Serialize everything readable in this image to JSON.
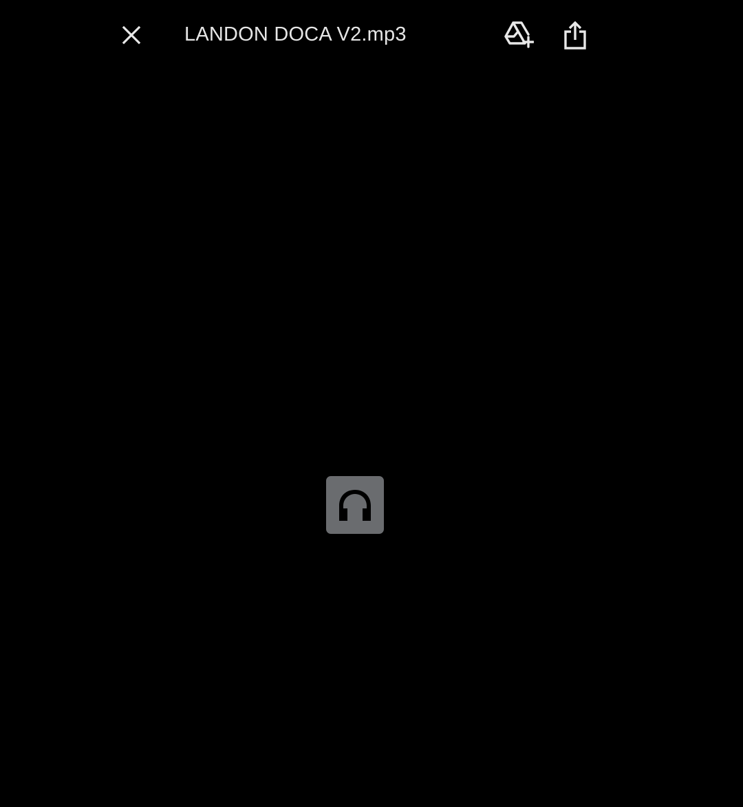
{
  "toolbar": {
    "close_icon": "close-icon",
    "title": "LANDON DOCA V2.mp3",
    "add_to_drive_icon": "add-to-drive-icon",
    "share_icon": "share-icon"
  },
  "viewer": {
    "file_type_icon": "headphones-icon",
    "file_type_tile_color": "#6a6c6f",
    "icon_color": "#000000"
  },
  "colors": {
    "background": "#000000",
    "foreground": "#e8e8e8"
  }
}
